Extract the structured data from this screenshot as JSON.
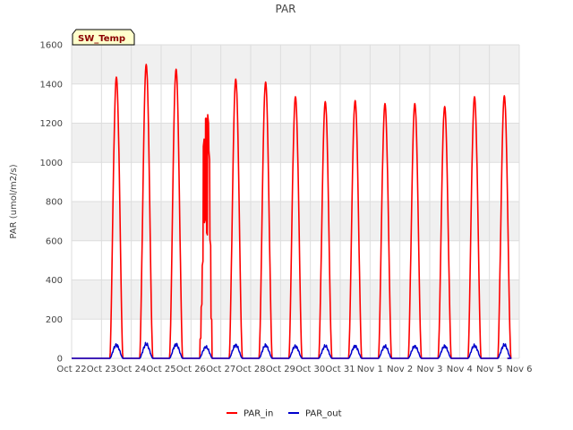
{
  "chart_data": {
    "type": "line",
    "title": "PAR",
    "xlabel": "",
    "ylabel": "PAR (umol/m2/s)",
    "badge": "SW_Temp",
    "ylim": [
      0,
      1600
    ],
    "yticks": [
      0,
      200,
      400,
      600,
      800,
      1000,
      1200,
      1400,
      1600
    ],
    "xlim": [
      0,
      15
    ],
    "xticks": [
      {
        "x": 0,
        "label": "Oct 22"
      },
      {
        "x": 1,
        "label": "Oct 23"
      },
      {
        "x": 2,
        "label": "Oct 24"
      },
      {
        "x": 3,
        "label": "Oct 25"
      },
      {
        "x": 4,
        "label": "Oct 26"
      },
      {
        "x": 5,
        "label": "Oct 27"
      },
      {
        "x": 6,
        "label": "Oct 28"
      },
      {
        "x": 7,
        "label": "Oct 29"
      },
      {
        "x": 8,
        "label": "Oct 30"
      },
      {
        "x": 9,
        "label": "Oct 31"
      },
      {
        "x": 10,
        "label": "Nov 1"
      },
      {
        "x": 11,
        "label": "Nov 2"
      },
      {
        "x": 12,
        "label": "Nov 3"
      },
      {
        "x": 13,
        "label": "Nov 4"
      },
      {
        "x": 14,
        "label": "Nov 5"
      },
      {
        "x": 15,
        "label": "Nov 6"
      }
    ],
    "grid": true,
    "legend_position": "bottom-center",
    "series": [
      {
        "name": "PAR_in",
        "color": "#ff0000",
        "daily_peaks": [
          {
            "date": "Oct 23",
            "peak": 1435
          },
          {
            "date": "Oct 24",
            "peak": 1500
          },
          {
            "date": "Oct 25",
            "peak": 1475
          },
          {
            "date": "Oct 26",
            "peak": 1290
          },
          {
            "date": "Oct 27",
            "peak": 1425
          },
          {
            "date": "Oct 28",
            "peak": 1410
          },
          {
            "date": "Oct 29",
            "peak": 1335
          },
          {
            "date": "Oct 30",
            "peak": 1310
          },
          {
            "date": "Oct 31",
            "peak": 1315
          },
          {
            "date": "Nov 1",
            "peak": 1300
          },
          {
            "date": "Nov 2",
            "peak": 1300
          },
          {
            "date": "Nov 3",
            "peak": 1285
          },
          {
            "date": "Nov 4",
            "peak": 1335
          },
          {
            "date": "Nov 5",
            "peak": 1340
          }
        ]
      },
      {
        "name": "PAR_out",
        "color": "#0000cc",
        "daily_peaks": [
          {
            "date": "Oct 23",
            "peak": 68
          },
          {
            "date": "Oct 24",
            "peak": 72
          },
          {
            "date": "Oct 25",
            "peak": 70
          },
          {
            "date": "Oct 26",
            "peak": 58
          },
          {
            "date": "Oct 27",
            "peak": 68
          },
          {
            "date": "Oct 28",
            "peak": 66
          },
          {
            "date": "Oct 29",
            "peak": 62
          },
          {
            "date": "Oct 30",
            "peak": 62
          },
          {
            "date": "Oct 31",
            "peak": 62
          },
          {
            "date": "Nov 1",
            "peak": 62
          },
          {
            "date": "Nov 2",
            "peak": 62
          },
          {
            "date": "Nov 3",
            "peak": 62
          },
          {
            "date": "Nov 4",
            "peak": 65
          },
          {
            "date": "Nov 5",
            "peak": 68
          }
        ]
      }
    ]
  },
  "colors": {
    "band": "#f0f0f0",
    "grid": "#dddddd",
    "badge_fill": "#ffffcc"
  }
}
